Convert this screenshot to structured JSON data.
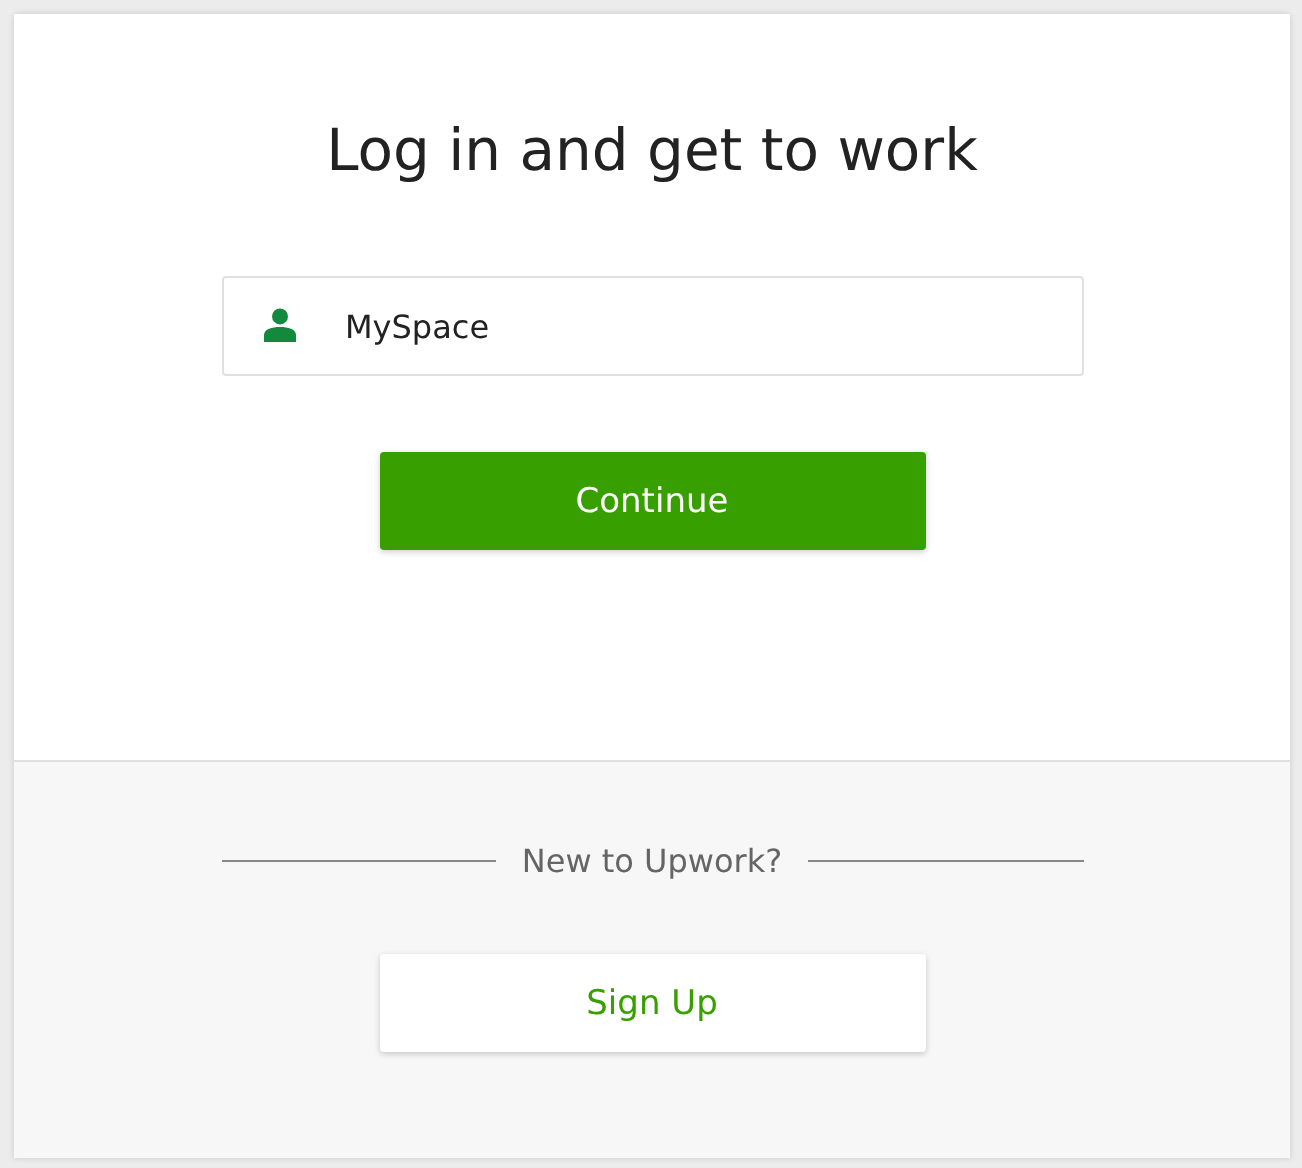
{
  "title": "Log in and get to work",
  "username_field": {
    "value": "MySpace"
  },
  "continue_button": {
    "label": "Continue"
  },
  "divider_text": "New to Upwork?",
  "signup_button": {
    "label": "Sign Up"
  }
}
